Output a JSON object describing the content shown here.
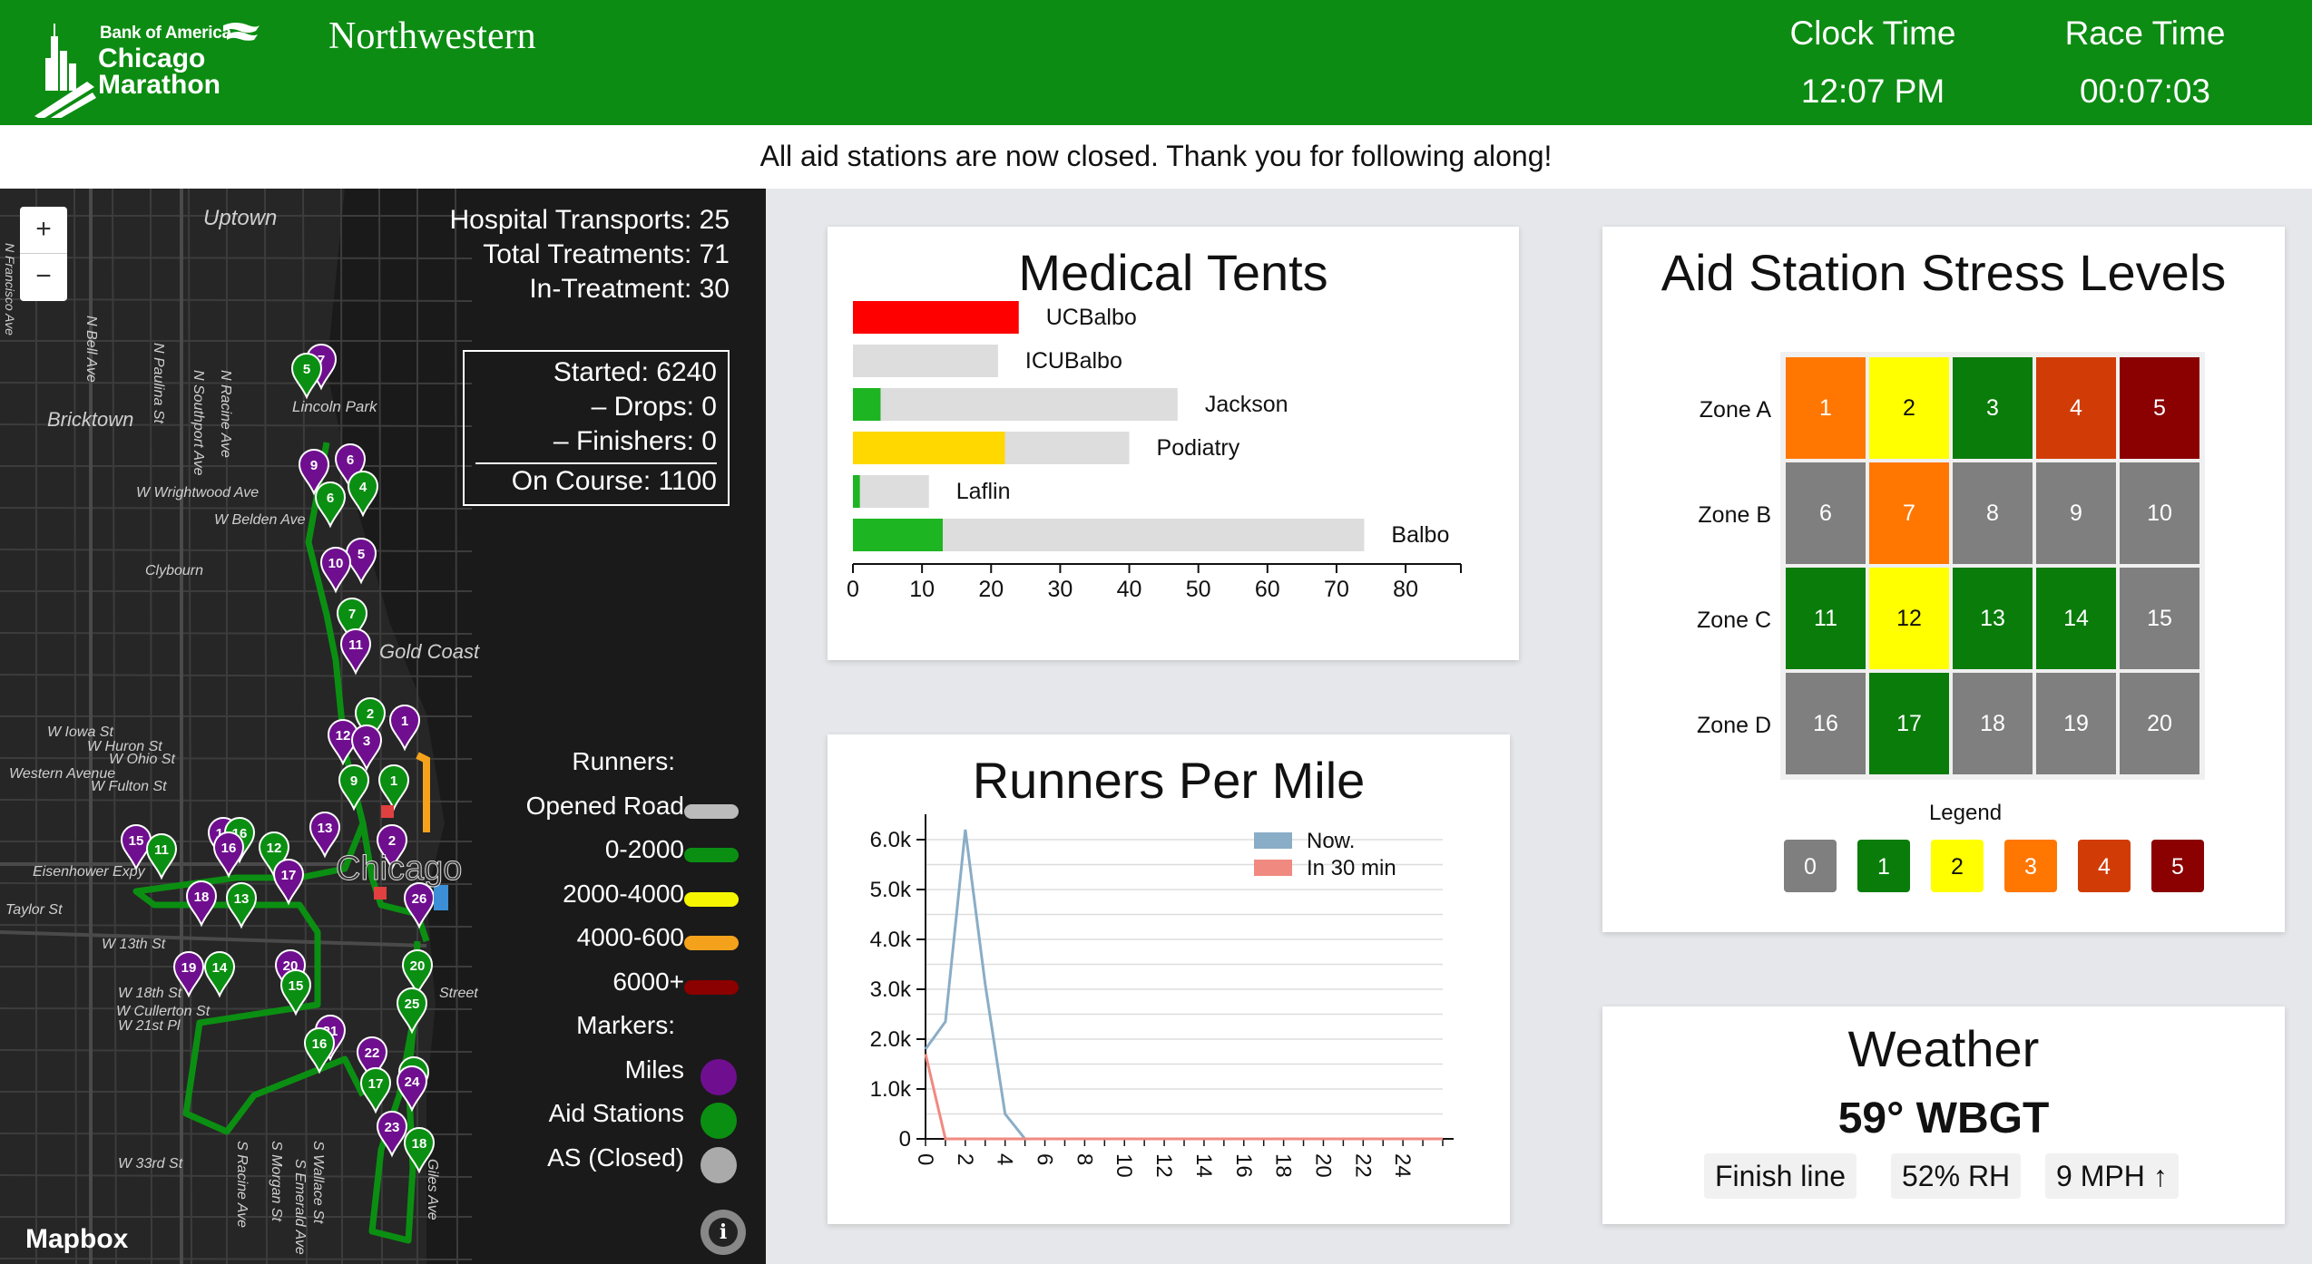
{
  "header": {
    "logo_bank": "Bank of America",
    "logo_chicago": "Chicago",
    "logo_marathon": "Marathon",
    "sponsor": "Northwestern",
    "clock_label": "Clock Time",
    "clock_value": "12:07 PM",
    "race_label": "Race Time",
    "race_value": "00:07:03"
  },
  "banner": "All aid stations are now closed. Thank you for following along!",
  "map": {
    "zoom_in": "+",
    "zoom_out": "−",
    "hospital_transports": "Hospital Transports: 25",
    "total_treatments": "Total Treatments: 71",
    "in_treatment": "In-Treatment: 30",
    "started": "Started: 6240",
    "drops": "– Drops: 0",
    "finishers": "– Finishers: 0",
    "on_course": "On Course: 1100",
    "place_labels": [
      "Uptown",
      "Bricktown",
      "Lincoln Park",
      "Clybourn",
      "Gold Coast",
      "Western Avenue",
      "Chicago",
      "Eisenhower Expy",
      "W 13th St",
      "W 18th St",
      "W Cullerton St",
      "W 21st Pl",
      "W 33rd St",
      "W Iowa St",
      "W Huron St",
      "W Ohio St",
      "W Fulton St",
      "W Wrightwood Ave",
      "W Belden Ave",
      "N Bell Ave",
      "N Paulina St",
      "N Southport Ave",
      "N Racine Ave",
      "S Morgan St",
      "S Wallace St",
      "S Emerald Ave",
      "S Racine Ave",
      "Giles Ave",
      "Street",
      "Taylor St",
      "N Francisco Ave"
    ],
    "mapbox": "Mapbox",
    "info": "i",
    "legend": {
      "runners_title": "Runners:",
      "runner_items": [
        {
          "label": "Opened Road",
          "color": "#bbbbbb"
        },
        {
          "label": "0-2000",
          "color": "#0b8f12"
        },
        {
          "label": "2000-4000",
          "color": "#f6f600"
        },
        {
          "label": "4000-600",
          "color": "#f4a21c"
        },
        {
          "label": "6000+",
          "color": "#8b0000"
        }
      ],
      "markers_title": "Markers:",
      "marker_items": [
        {
          "label": "Miles",
          "color": "#6f0f8f"
        },
        {
          "label": "Aid Stations",
          "color": "#0b8f12"
        },
        {
          "label": "AS (Closed)",
          "color": "#aaaaaa"
        }
      ]
    }
  },
  "medical": {
    "title": "Medical Tents",
    "chart_data": {
      "type": "bar",
      "orientation": "horizontal",
      "categories": [
        "UCBalbo",
        "ICUBalbo",
        "Jackson",
        "Podiatry",
        "Laflin",
        "Balbo"
      ],
      "values": [
        24,
        0,
        4,
        22,
        1,
        13
      ],
      "capacity": [
        24,
        21,
        47,
        40,
        11,
        74
      ],
      "fill_colors": [
        "#ff0000",
        "#dddddd",
        "#1db521",
        "#ffd800",
        "#1db521",
        "#1db521"
      ],
      "xlim": [
        0,
        88
      ],
      "xticks": [
        0,
        10,
        20,
        30,
        40,
        50,
        60,
        70,
        80
      ]
    }
  },
  "runners_per_mile": {
    "title": "Runners Per Mile",
    "chart_data": {
      "type": "line",
      "x": [
        0,
        1,
        2,
        3,
        4,
        5,
        6,
        7,
        8,
        9,
        10,
        11,
        12,
        13,
        14,
        15,
        16,
        17,
        18,
        19,
        20,
        21,
        22,
        23,
        24,
        25,
        26
      ],
      "series": [
        {
          "name": "Now.",
          "color": "#8aadc7",
          "values": [
            1800,
            2350,
            6200,
            3100,
            500,
            0,
            0,
            0,
            0,
            0,
            0,
            0,
            0,
            0,
            0,
            0,
            0,
            0,
            0,
            0,
            0,
            0,
            0,
            0,
            0,
            0,
            0
          ]
        },
        {
          "name": "In 30 min",
          "color": "#f08a80",
          "values": [
            1700,
            0,
            0,
            0,
            0,
            0,
            0,
            0,
            0,
            0,
            0,
            0,
            0,
            0,
            0,
            0,
            0,
            0,
            0,
            0,
            0,
            0,
            0,
            0,
            0,
            0,
            0
          ]
        }
      ],
      "ylim": [
        0,
        6400
      ],
      "yticks": [
        0,
        1000,
        2000,
        3000,
        4000,
        5000,
        6000
      ],
      "ytick_labels": [
        "0",
        "1.0k",
        "2.0k",
        "3.0k",
        "4.0k",
        "5.0k",
        "6.0k"
      ],
      "xticks": [
        0,
        2,
        4,
        6,
        8,
        10,
        12,
        14,
        16,
        18,
        20,
        22,
        24
      ],
      "grid": true,
      "legend": "top-right"
    }
  },
  "stress": {
    "title": "Aid Station Stress Levels",
    "zones": [
      "Zone A",
      "Zone B",
      "Zone C",
      "Zone D"
    ],
    "cells": [
      [
        {
          "n": "1",
          "lvl": 3
        },
        {
          "n": "2",
          "lvl": 2
        },
        {
          "n": "3",
          "lvl": 1
        },
        {
          "n": "4",
          "lvl": 4
        },
        {
          "n": "5",
          "lvl": 5
        }
      ],
      [
        {
          "n": "6",
          "lvl": 0
        },
        {
          "n": "7",
          "lvl": 3
        },
        {
          "n": "8",
          "lvl": 0
        },
        {
          "n": "9",
          "lvl": 0
        },
        {
          "n": "10",
          "lvl": 0
        }
      ],
      [
        {
          "n": "11",
          "lvl": 1
        },
        {
          "n": "12",
          "lvl": 2
        },
        {
          "n": "13",
          "lvl": 1
        },
        {
          "n": "14",
          "lvl": 1
        },
        {
          "n": "15",
          "lvl": 0
        }
      ],
      [
        {
          "n": "16",
          "lvl": 0
        },
        {
          "n": "17",
          "lvl": 1
        },
        {
          "n": "18",
          "lvl": 0
        },
        {
          "n": "19",
          "lvl": 0
        },
        {
          "n": "20",
          "lvl": 0
        }
      ]
    ],
    "legend_title": "Legend",
    "levels": [
      "0",
      "1",
      "2",
      "3",
      "4",
      "5"
    ],
    "level_colors": [
      "#7f7f7f",
      "#0a7c0a",
      "#ffff00",
      "#ff7700",
      "#d13c06",
      "#8b0000"
    ]
  },
  "weather": {
    "title": "Weather",
    "wbgt": "59° WBGT",
    "location": "Finish line",
    "humidity": "52% RH",
    "wind": "9 MPH ↑"
  }
}
